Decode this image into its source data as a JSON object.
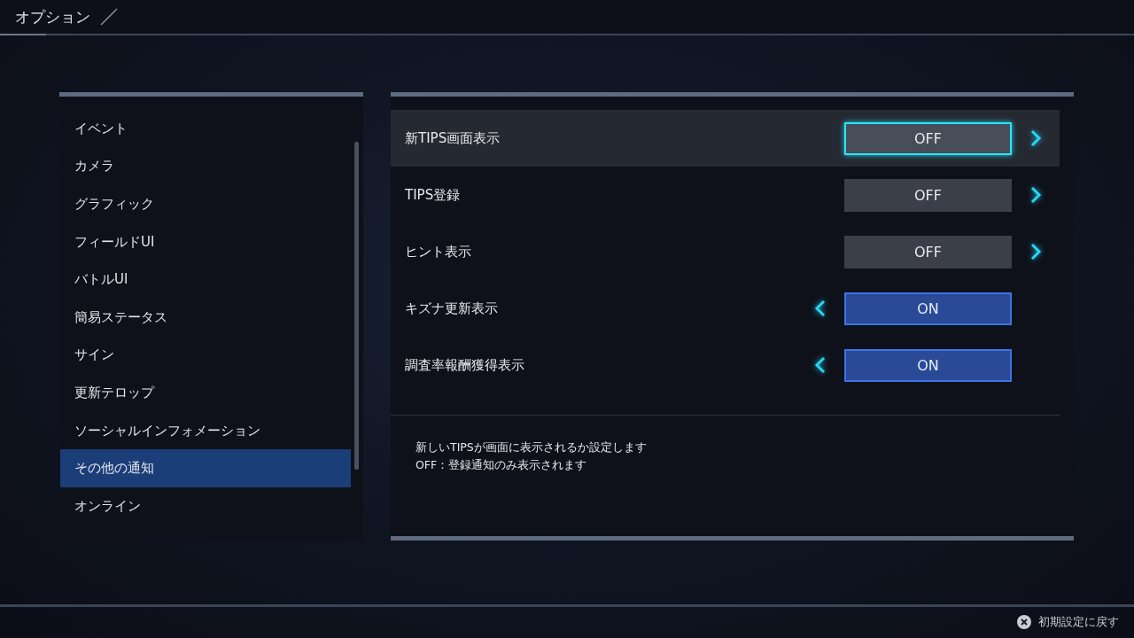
{
  "header": {
    "title": "オプション"
  },
  "categories": [
    {
      "label": "イベント",
      "selected": false
    },
    {
      "label": "カメラ",
      "selected": false
    },
    {
      "label": "グラフィック",
      "selected": false
    },
    {
      "label": "フィールドUI",
      "selected": false
    },
    {
      "label": "バトルUI",
      "selected": false
    },
    {
      "label": "簡易ステータス",
      "selected": false
    },
    {
      "label": "サイン",
      "selected": false
    },
    {
      "label": "更新テロップ",
      "selected": false
    },
    {
      "label": "ソーシャルインフォメーション",
      "selected": false
    },
    {
      "label": "その他の通知",
      "selected": true
    },
    {
      "label": "オンライン",
      "selected": false
    }
  ],
  "settings": [
    {
      "label": "新TIPS画面表示",
      "value": "OFF",
      "on": false,
      "selected": true
    },
    {
      "label": "TIPS登録",
      "value": "OFF",
      "on": false,
      "selected": false
    },
    {
      "label": "ヒント表示",
      "value": "OFF",
      "on": false,
      "selected": false
    },
    {
      "label": "キズナ更新表示",
      "value": "ON",
      "on": true,
      "selected": false
    },
    {
      "label": "調査率報酬獲得表示",
      "value": "ON",
      "on": true,
      "selected": false
    }
  ],
  "description": [
    "新しいTIPSが画面に表示されるか設定します",
    "OFF：登録通知のみ表示されます"
  ],
  "footer": {
    "reset_label": "初期設定に戻す"
  }
}
